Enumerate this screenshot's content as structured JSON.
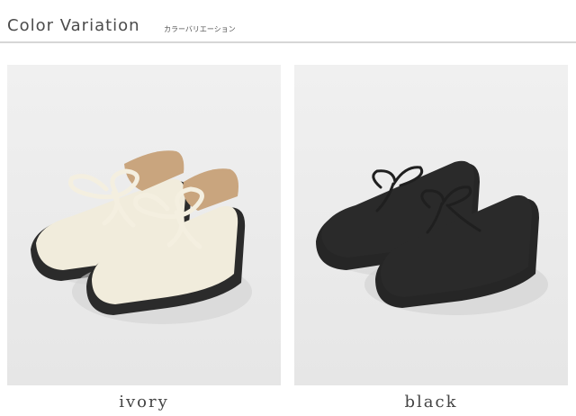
{
  "header": {
    "title": "Color Variation",
    "subtitle": "カラーバリエーション"
  },
  "variants": [
    {
      "label": "ivory",
      "upper_color": "#f1ecdc",
      "sole_color": "#2b2b2b",
      "lace_color": "#f4efe0",
      "lining_color": "#c9a57e"
    },
    {
      "label": "black",
      "upper_color": "#2a2a2a",
      "sole_color": "#262626",
      "lace_color": "#1f1f1f",
      "lining_color": "#1c1c1c"
    }
  ]
}
